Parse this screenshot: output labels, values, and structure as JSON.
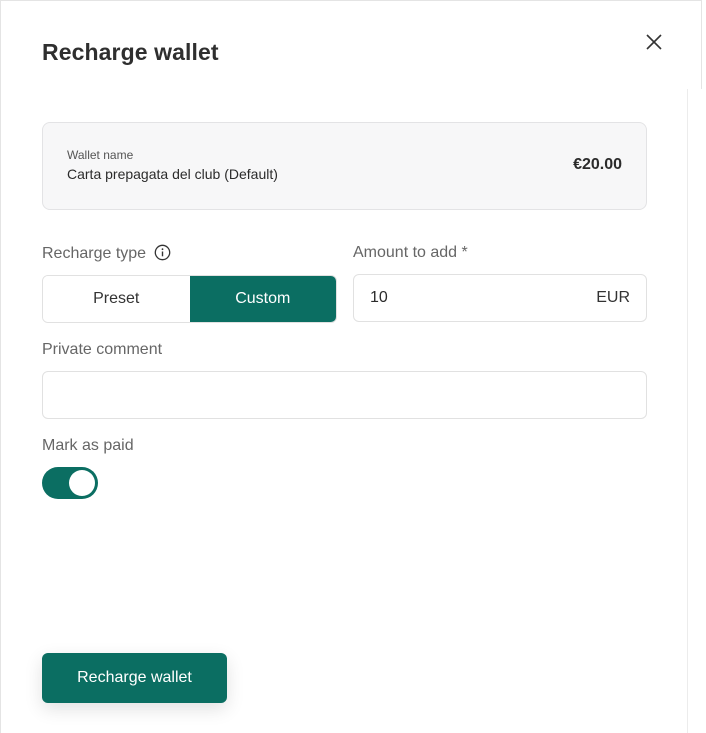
{
  "modal": {
    "title": "Recharge wallet"
  },
  "wallet": {
    "small_label": "Wallet name",
    "name": "Carta prepagata del club (Default)",
    "balance": "€20.00"
  },
  "recharge_type": {
    "label": "Recharge type",
    "options": [
      {
        "label": "Preset",
        "active": false
      },
      {
        "label": "Custom",
        "active": true
      }
    ]
  },
  "amount": {
    "label": "Amount to add *",
    "value": "10",
    "currency": "EUR"
  },
  "comment": {
    "label": "Private comment",
    "value": ""
  },
  "mark_paid": {
    "label": "Mark as paid",
    "on": true
  },
  "footer": {
    "submit_label": "Recharge wallet"
  },
  "colors": {
    "accent": "#0b6e62",
    "card_bg": "#f7f7f8"
  },
  "icons": {
    "close": "close-icon",
    "info": "info-icon"
  }
}
